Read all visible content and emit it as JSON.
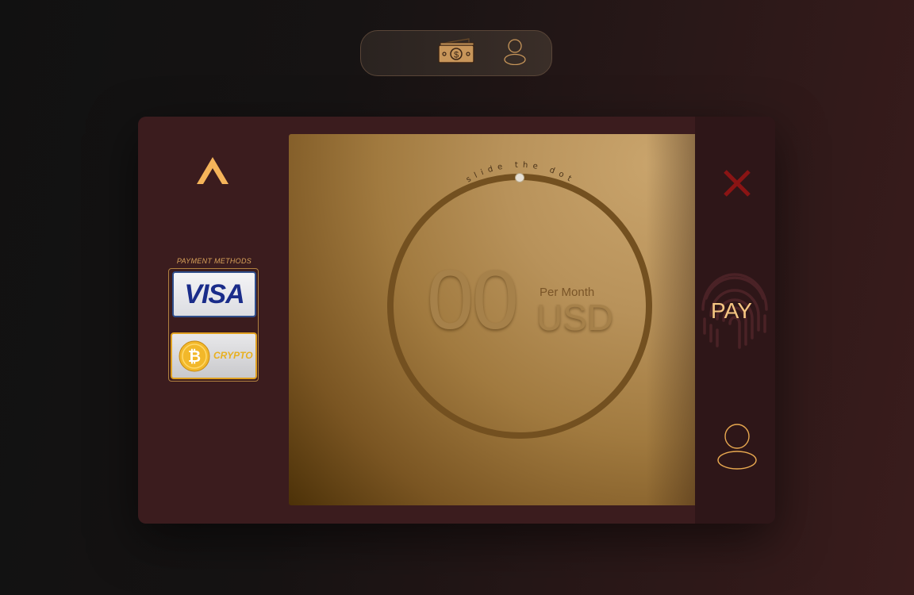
{
  "topbar": {
    "icons": [
      "money-icon",
      "user-icon"
    ]
  },
  "sidebar": {
    "payment_methods_title": "PAYMENT METHODS",
    "methods": [
      {
        "label": "VISA"
      },
      {
        "label": "CRYPTO"
      }
    ]
  },
  "main": {
    "hint": "slide the dot",
    "amount": "00",
    "period": "Per Month",
    "currency": "USD"
  },
  "actions": {
    "pay_label": "PAY"
  },
  "colors": {
    "accent": "#f5b45a",
    "card_bg": "#3b1c1e",
    "close": "#8a1414",
    "visa_blue": "#1a2c8a",
    "crypto_gold": "#e8b020"
  }
}
